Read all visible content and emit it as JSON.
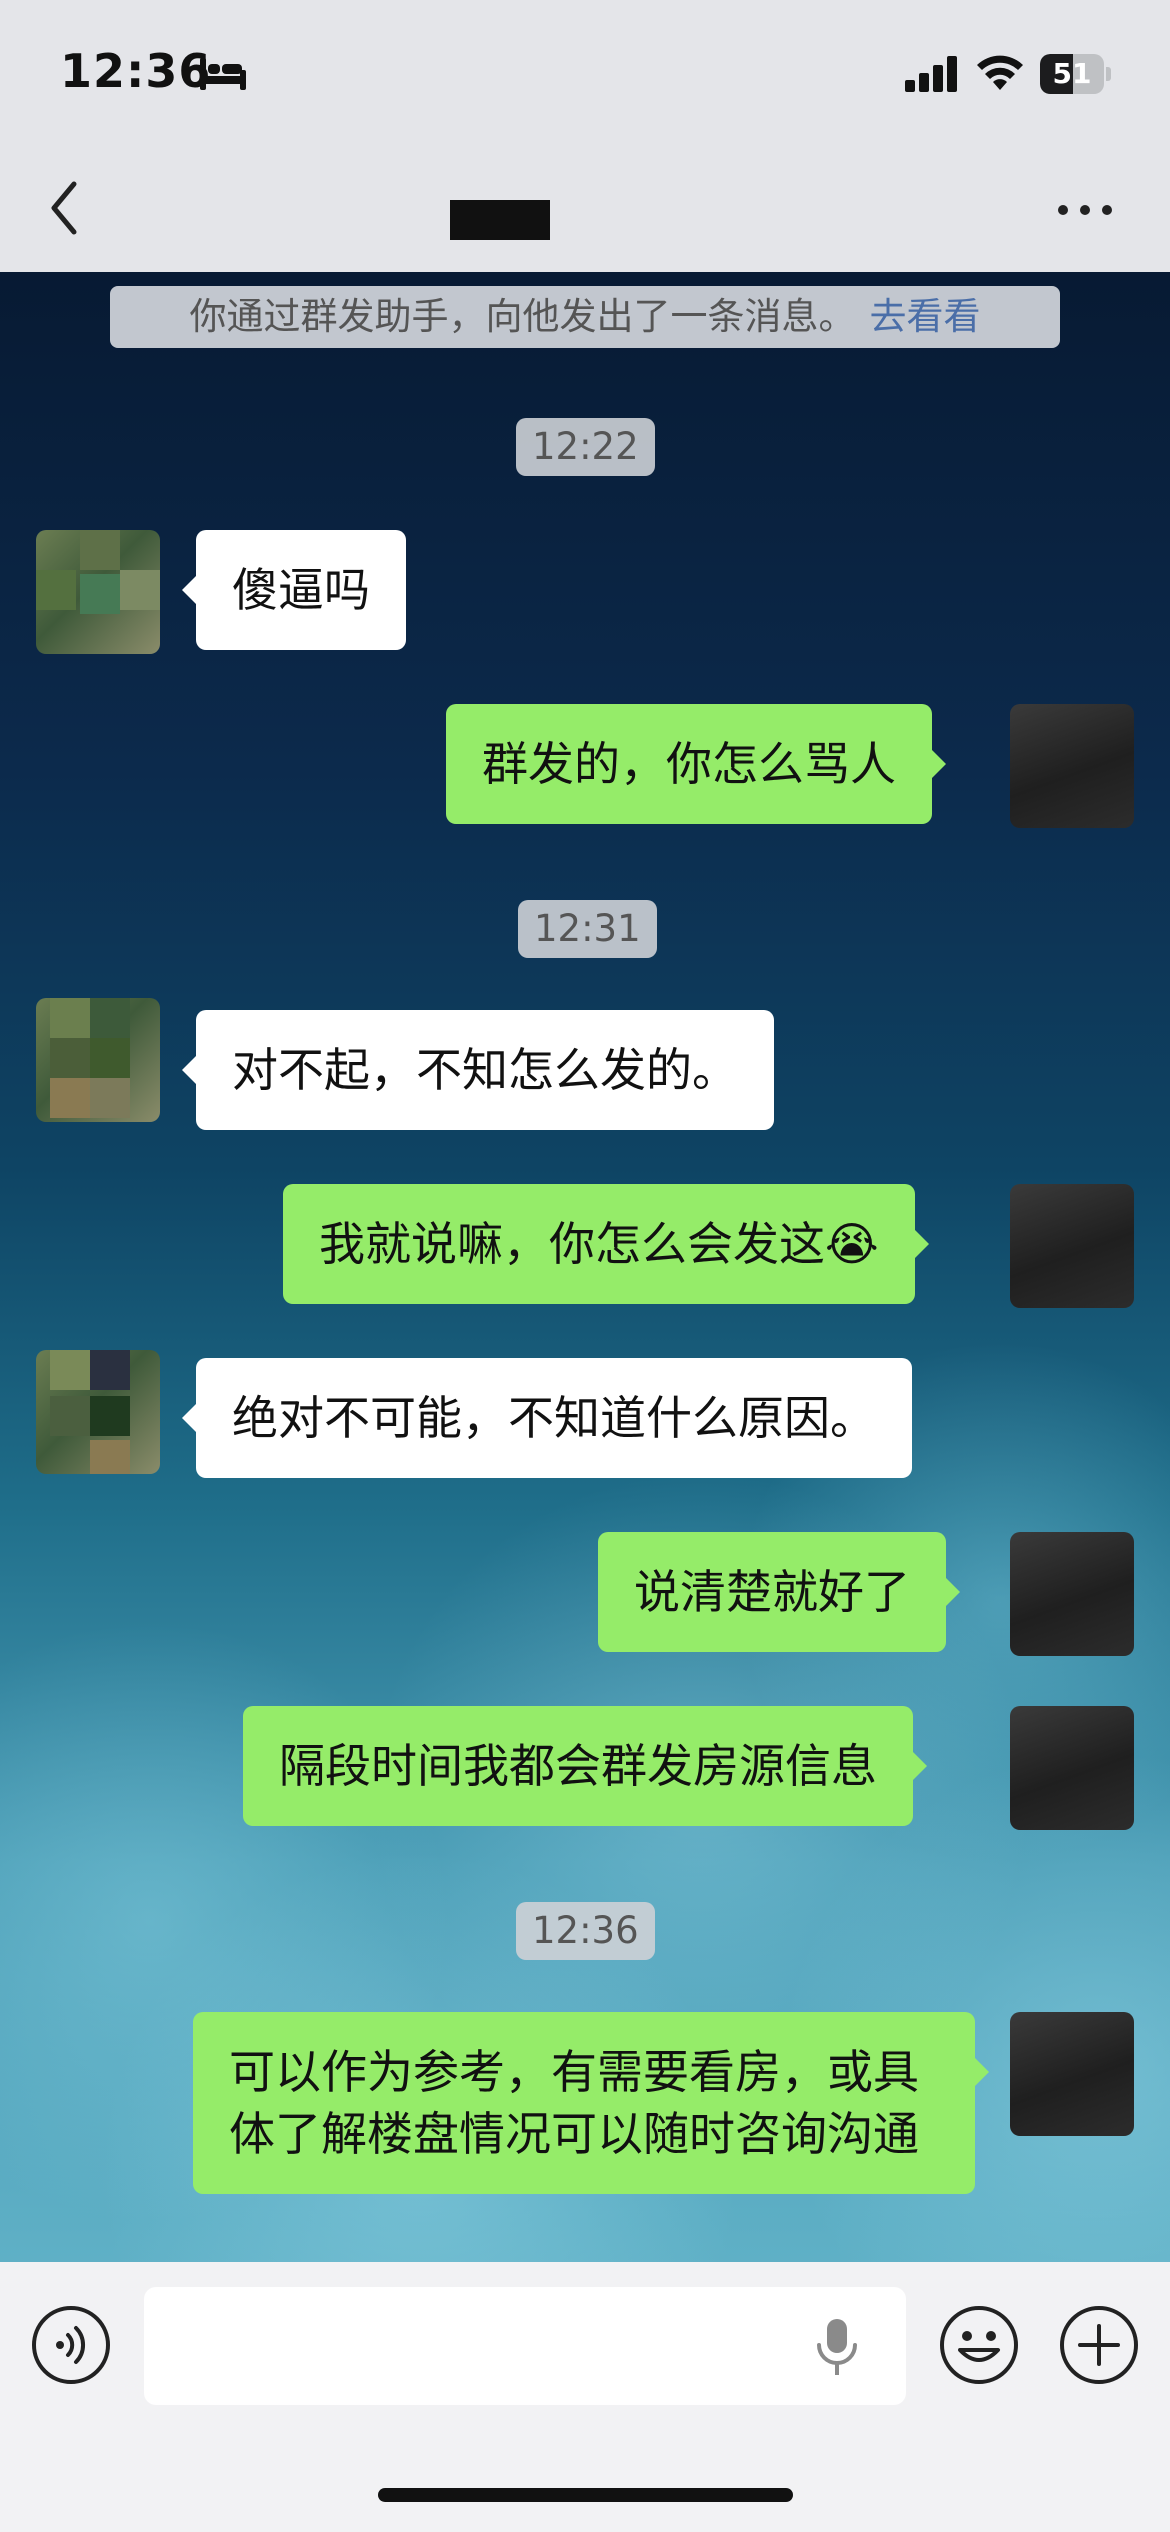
{
  "status_bar": {
    "time": "12:36",
    "battery_level": "51",
    "icons": [
      "bed-icon",
      "cellular-signal-icon",
      "wifi-icon",
      "battery-icon"
    ]
  },
  "nav": {
    "title": "",
    "icons": [
      "back-chevron-icon",
      "more-options-icon"
    ]
  },
  "chat": {
    "system_notice": {
      "text": "你通过群发助手，向他发出了一条消息。",
      "link": "去看看"
    },
    "timestamps": [
      "12:22",
      "12:31",
      "12:36"
    ],
    "messages": [
      {
        "sender": "peer",
        "text": "傻逼吗"
      },
      {
        "sender": "me",
        "text": "群发的，你怎么骂人"
      },
      {
        "sender": "peer",
        "text": "对不起，不知怎么发的。"
      },
      {
        "sender": "me",
        "text": "我就说嘛，你怎么会发这😭"
      },
      {
        "sender": "peer",
        "text": "绝对不可能，不知道什么原因。"
      },
      {
        "sender": "me",
        "text": "说清楚就好了"
      },
      {
        "sender": "me",
        "text": "隔段时间我都会群发房源信息"
      },
      {
        "sender": "me",
        "text": "可以作为参考，有需要看房，或具体了解楼盘情况可以随时咨询沟通"
      }
    ]
  },
  "input_bar": {
    "placeholder": "",
    "icons": [
      "voice-icon",
      "mic-icon",
      "emoji-icon",
      "plus-icon"
    ]
  },
  "colors": {
    "my_bubble": "#95ec69",
    "peer_bubble": "#ffffff",
    "link": "#4a6ea8"
  }
}
